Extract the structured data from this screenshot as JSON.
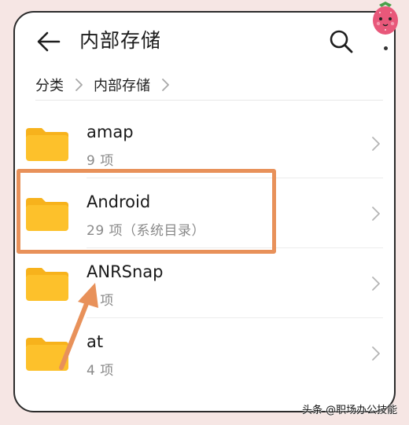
{
  "header": {
    "title": "内部存储",
    "back_icon": "back-arrow-icon",
    "search_icon": "search-icon"
  },
  "breadcrumb": {
    "items": [
      "分类",
      "内部存储"
    ]
  },
  "files": [
    {
      "name": "amap",
      "meta": "9 项"
    },
    {
      "name": "Android",
      "meta": "29 项（系统目录）"
    },
    {
      "name": "ANRSnap",
      "meta": "1 项"
    },
    {
      "name": "at",
      "meta": "4 项"
    }
  ],
  "annotation": {
    "highlight_color": "#e8915a",
    "highlighted_item": "Android"
  },
  "colors": {
    "folder": "#fdc12b",
    "folder_tab": "#f7b21c",
    "background": "#f6e6e4"
  },
  "watermark": {
    "text": "头条 @职场办公技能"
  }
}
